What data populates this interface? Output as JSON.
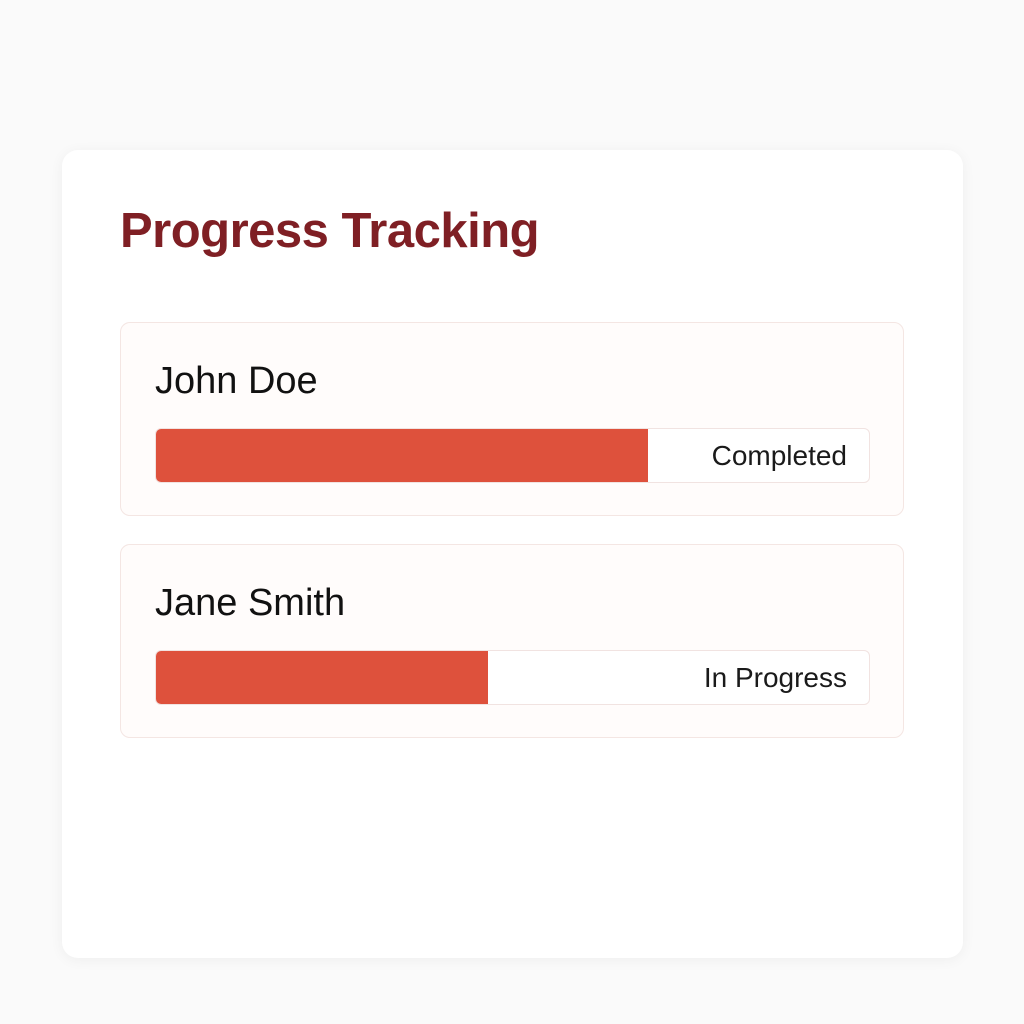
{
  "colors": {
    "title": "#7f1f24",
    "bar_fill": "#de513c"
  },
  "card": {
    "title": "Progress Tracking"
  },
  "entries": [
    {
      "name": "John Doe",
      "status": "Completed",
      "progress": 0.69
    },
    {
      "name": "Jane Smith",
      "status": "In Progress",
      "progress": 0.465
    }
  ]
}
